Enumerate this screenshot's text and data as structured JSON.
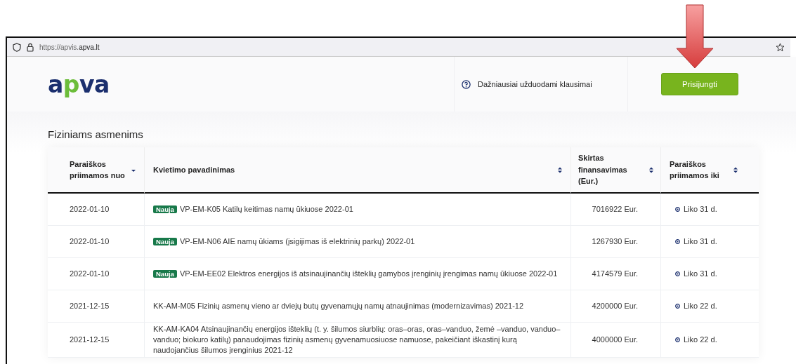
{
  "browser": {
    "url_plain": "https://apvis.",
    "url_bold": "apva.lt"
  },
  "header": {
    "logo": "apva",
    "faq_link": "Dažniausiai užduodami klausimai",
    "login_button": "Prisijungti"
  },
  "section_title": "Fiziniams asmenims",
  "table": {
    "columns": [
      {
        "label": "Paraiškos priimamos nuo",
        "kind": "sorted"
      },
      {
        "label": "Kvietimo pavadinimas",
        "kind": "sortable"
      },
      {
        "label": "Skirtas finansavimas (Eur.)",
        "kind": "sortable"
      },
      {
        "label": "Paraiškos priimamos iki",
        "kind": "sortable"
      }
    ],
    "rows": [
      {
        "date": "2022-01-10",
        "badge": "Nauja",
        "title": "VP-EM-K05 Katilų keitimas namų ūkiuose 2022-01",
        "amount": "7016922 Eur.",
        "remaining": "Liko 31 d."
      },
      {
        "date": "2022-01-10",
        "badge": "Nauja",
        "title": "VP-EM-N06 AIE namų ūkiams (įsigijimas iš elektrinių parkų) 2022-01",
        "amount": "1267930 Eur.",
        "remaining": "Liko 31 d."
      },
      {
        "date": "2022-01-10",
        "badge": "Nauja",
        "title": "VP-EM-EE02 Elektros energijos iš atsinaujinančių išteklių gamybos įrenginių įrengimas namų ūkiuose 2022-01",
        "amount": "4174579 Eur.",
        "remaining": "Liko 31 d."
      },
      {
        "date": "2021-12-15",
        "title": "KK-AM-M05 Fizinių asmenų vieno ar dviejų butų gyvenamųjų namų atnaujinimas (modernizavimas) 2021-12",
        "amount": "4200000 Eur.",
        "remaining": "Liko 22 d."
      },
      {
        "date": "2021-12-15",
        "title": "KK-AM-KA04 Atsinaujinančių energijos išteklių (t. y. šilumos siurblių: oras–oras, oras–vanduo, žemė –vanduo, vanduo–vanduo; biokuro katilų) panaudojimas fizinių asmenų gyvenamuosiuose namuose, pakeičiant iškastinį kurą naudojančius šilumos įrenginius 2021-12",
        "amount": "4000000 Eur.",
        "remaining": "Liko 22 d."
      }
    ]
  }
}
